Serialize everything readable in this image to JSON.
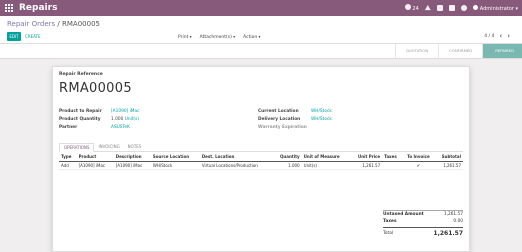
{
  "topbar": {
    "app_name": "Repairs",
    "activity_count": "24",
    "user_name": "Administrator"
  },
  "breadcrumb": {
    "parent": "Repair Orders",
    "separator": "/",
    "current": "RMA00005"
  },
  "toolbar": {
    "edit_label": "EDIT",
    "create_label": "CREATE",
    "print_label": "Print",
    "attachments_label": "Attachment(s)",
    "action_label": "Action",
    "pager_value": "4 / 4"
  },
  "status": {
    "stages": [
      "QUOTATION",
      "CONFIRMED",
      "REPAIRED"
    ],
    "active": "REPAIRED"
  },
  "form": {
    "reference_label": "Repair Reference",
    "reference": "RMA00005",
    "product_label": "Product to Repair",
    "product": "[A1090] iMac",
    "quantity_label": "Product Quantity",
    "quantity": "1.000",
    "quantity_uom": "Unit(s)",
    "partner_label": "Partner",
    "partner": "ASUSTeK",
    "location_label": "Current Location",
    "location": "WH/Stock",
    "delivery_label": "Delivery Location",
    "delivery": "WH/Stock",
    "warranty_label": "Warranty Expiration"
  },
  "tabs": [
    "OPERATIONS",
    "INVOICING",
    "NOTES"
  ],
  "operations": {
    "headers": [
      "Type",
      "Product",
      "Description",
      "Source Location",
      "Dest. Location",
      "Quantity",
      "Unit of Measure",
      "Unit Price",
      "Taxes",
      "To Invoice",
      "Subtotal"
    ],
    "rows": [
      [
        "Add",
        "[A1090] iMac",
        "[A1090] iMac",
        "WH/Stock",
        "Virtual Locations/Production",
        "1.000",
        "Unit(s)",
        "1,261.57",
        "",
        "✔",
        "1,261.57"
      ]
    ]
  },
  "totals": {
    "untaxed_label": "Untaxed Amount",
    "untaxed": "1,261.57",
    "taxes_label": "Taxes",
    "taxes": "0.00",
    "total_label": "Total",
    "total": "1,261.57"
  },
  "colors": {
    "brand": "#875a7b",
    "accent": "#00a09d",
    "stage_active": "#7ab8b2"
  }
}
